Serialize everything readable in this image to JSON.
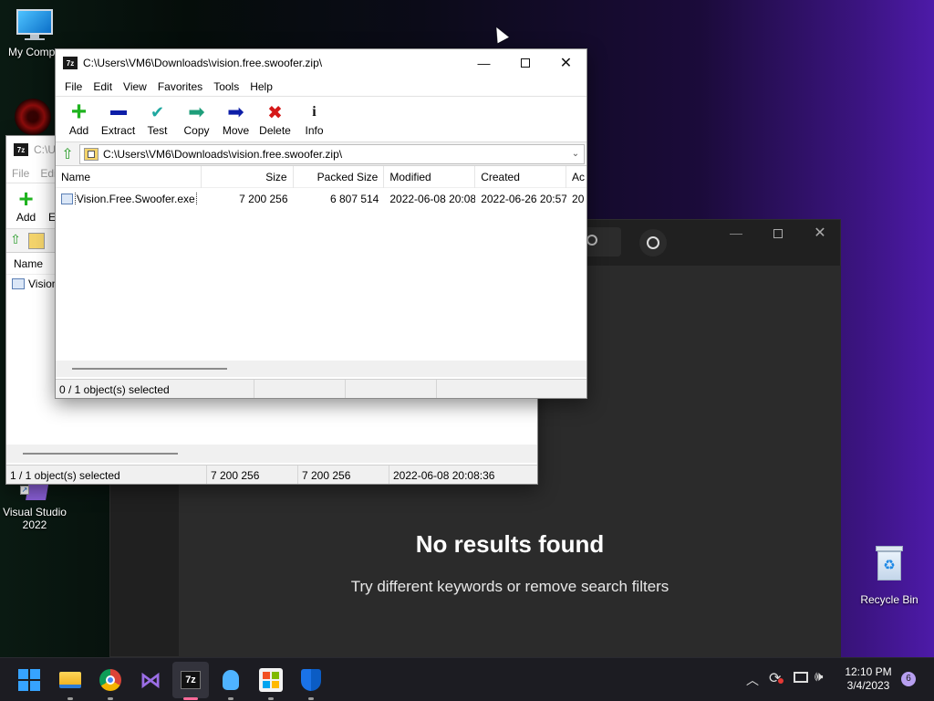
{
  "desktop": {
    "icons": [
      {
        "label": "My Compu"
      },
      {
        "label": "Visual Studio 2022"
      },
      {
        "label": "Recycle Bin"
      }
    ]
  },
  "search_window": {
    "no_results_title": "No results found",
    "no_results_subtitle": "Try different keywords or remove search filters"
  },
  "back_window": {
    "title": "C:\\U",
    "menu": [
      "File",
      "Edi"
    ],
    "toolbar": {
      "add": "Add",
      "extract": "Ex"
    },
    "col_name": "Name",
    "row_name": "Vision",
    "status": {
      "selected": "1 / 1 object(s) selected",
      "size": "7 200 256",
      "packed": "7 200 256",
      "modified": "2022-06-08 20:08:36"
    }
  },
  "front_window": {
    "title": "C:\\Users\\VM6\\Downloads\\vision.free.swoofer.zip\\",
    "menu": [
      "File",
      "Edit",
      "View",
      "Favorites",
      "Tools",
      "Help"
    ],
    "toolbar": {
      "add": "Add",
      "extract": "Extract",
      "test": "Test",
      "copy": "Copy",
      "move": "Move",
      "delete": "Delete",
      "info": "Info"
    },
    "address": "C:\\Users\\VM6\\Downloads\\vision.free.swoofer.zip\\",
    "columns": [
      "Name",
      "Size",
      "Packed Size",
      "Modified",
      "Created",
      "Ac"
    ],
    "rows": [
      {
        "name": "Vision.Free.Swoofer.exe",
        "size": "7 200 256",
        "packed": "6 807 514",
        "modified": "2022-06-08 20:08",
        "created": "2022-06-26 20:57",
        "accessed": "20"
      }
    ],
    "status": {
      "selected": "0 / 1 object(s) selected"
    }
  },
  "taskbar": {
    "apps": [
      "start-icon",
      "file-explorer-icon",
      "chrome-icon",
      "visual-studio-icon",
      "7zip-icon",
      "tips-icon",
      "store-icon",
      "defender-icon"
    ],
    "time": "12:10 PM",
    "date": "3/4/2023",
    "notifications": "6"
  },
  "colors": {
    "accent_green": "#1fb31f",
    "accent_blue": "#0d1ea8",
    "delete_red": "#d51818",
    "dark_panel": "#202020"
  }
}
